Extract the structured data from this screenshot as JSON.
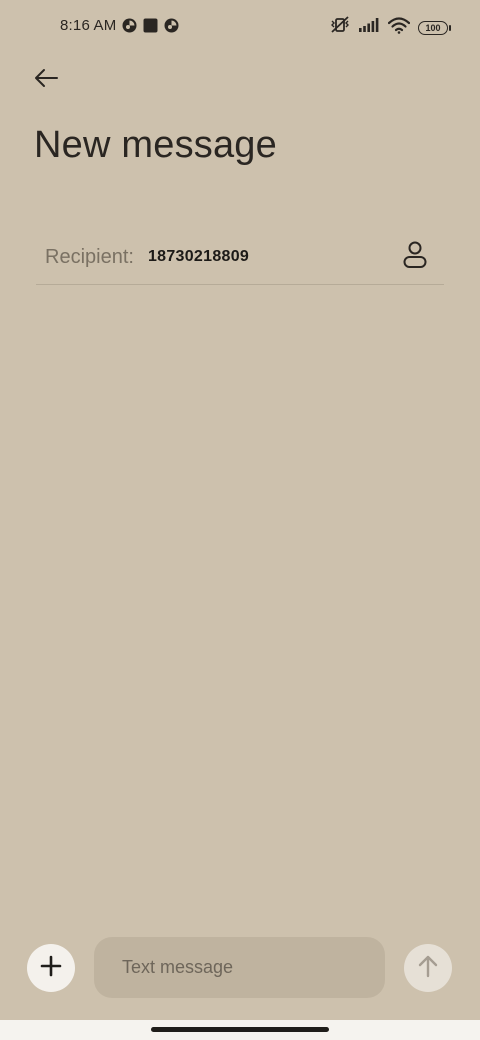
{
  "status_bar": {
    "time": "8:16 AM",
    "left_icons": [
      "app-notification-icon",
      "square-notification-icon",
      "app-notification-icon"
    ],
    "right_icons": [
      "mute-vibrate-icon",
      "signal-icon",
      "wifi-icon"
    ],
    "battery": "100"
  },
  "header": {
    "back_icon": "back-arrow-icon",
    "title": "New message"
  },
  "recipient": {
    "label": "Recipient:",
    "value": "18730218809",
    "contact_icon": "person-icon"
  },
  "composer": {
    "add_icon": "plus-icon",
    "placeholder": "Text message",
    "send_icon": "arrow-up-icon"
  },
  "colors": {
    "background": "#cdc1ad",
    "input_background": "#bfb39f",
    "button_background": "#f4f1ec",
    "text": "#2a2622"
  }
}
